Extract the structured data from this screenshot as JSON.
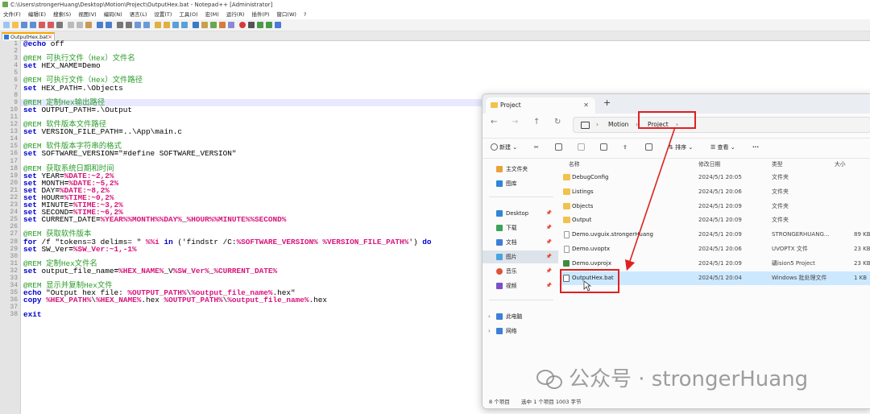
{
  "npp": {
    "title": "C:\\Users\\strongerHuang\\Desktop\\Motion\\Project\\OutputHex.bat - Notepad++ [Administrator]",
    "menu": [
      "文件(F)",
      "编辑(E)",
      "搜索(S)",
      "视图(V)",
      "编码(N)",
      "语言(L)",
      "设置(T)",
      "工具(O)",
      "宏(M)",
      "运行(R)",
      "插件(P)",
      "窗口(W)",
      "?"
    ],
    "tab_label": "OutputHex.bat",
    "lines": [
      {
        "n": "1",
        "t": [
          {
            "c": "kw",
            "s": "@echo"
          },
          {
            "c": "",
            "s": " off"
          }
        ]
      },
      {
        "n": "2",
        "t": []
      },
      {
        "n": "3",
        "t": [
          {
            "c": "cm",
            "s": "@REM 可执行文件（Hex）文件名"
          }
        ]
      },
      {
        "n": "4",
        "t": [
          {
            "c": "kw",
            "s": "set"
          },
          {
            "c": "",
            "s": " HEX_NAME"
          },
          {
            "c": "op",
            "s": "="
          },
          {
            "c": "",
            "s": "Demo"
          }
        ]
      },
      {
        "n": "5",
        "t": []
      },
      {
        "n": "6",
        "t": [
          {
            "c": "cm",
            "s": "@REM 可执行文件（Hex）文件路径"
          }
        ]
      },
      {
        "n": "7",
        "t": [
          {
            "c": "kw",
            "s": "set"
          },
          {
            "c": "",
            "s": " HEX_PATH"
          },
          {
            "c": "op",
            "s": "="
          },
          {
            "c": "",
            "s": ".\\Objects"
          }
        ]
      },
      {
        "n": "8",
        "t": []
      },
      {
        "n": "9",
        "t": [
          {
            "c": "cm",
            "s": "@REM 定制Hex输出路径"
          }
        ],
        "cur": true
      },
      {
        "n": "10",
        "t": [
          {
            "c": "kw",
            "s": "set"
          },
          {
            "c": "",
            "s": " OUTPUT_PATH"
          },
          {
            "c": "op",
            "s": "="
          },
          {
            "c": "",
            "s": ".\\Output"
          }
        ]
      },
      {
        "n": "11",
        "t": []
      },
      {
        "n": "12",
        "t": [
          {
            "c": "cm",
            "s": "@REM 软件版本文件路径"
          }
        ]
      },
      {
        "n": "13",
        "t": [
          {
            "c": "kw",
            "s": "set"
          },
          {
            "c": "",
            "s": " VERSION_FILE_PATH"
          },
          {
            "c": "op",
            "s": "="
          },
          {
            "c": "",
            "s": "..\\App\\main.c"
          }
        ]
      },
      {
        "n": "14",
        "t": []
      },
      {
        "n": "15",
        "t": [
          {
            "c": "cm",
            "s": "@REM 软件版本字符串的格式"
          }
        ]
      },
      {
        "n": "16",
        "t": [
          {
            "c": "kw",
            "s": "set"
          },
          {
            "c": "",
            "s": " SOFTWARE_VERSION"
          },
          {
            "c": "op",
            "s": "="
          },
          {
            "c": "",
            "s": "\"#define SOFTWARE_VERSION\""
          }
        ]
      },
      {
        "n": "17",
        "t": []
      },
      {
        "n": "18",
        "t": [
          {
            "c": "cm",
            "s": "@REM 获取系统日期和时间"
          }
        ]
      },
      {
        "n": "19",
        "t": [
          {
            "c": "kw",
            "s": "set"
          },
          {
            "c": "",
            "s": " YEAR"
          },
          {
            "c": "op",
            "s": "="
          },
          {
            "c": "var",
            "s": "%DATE:~2,2%"
          }
        ]
      },
      {
        "n": "20",
        "t": [
          {
            "c": "kw",
            "s": "set"
          },
          {
            "c": "",
            "s": " MONTH"
          },
          {
            "c": "op",
            "s": "="
          },
          {
            "c": "var",
            "s": "%DATE:~5,2%"
          }
        ]
      },
      {
        "n": "21",
        "t": [
          {
            "c": "kw",
            "s": "set"
          },
          {
            "c": "",
            "s": " DAY"
          },
          {
            "c": "op",
            "s": "="
          },
          {
            "c": "var",
            "s": "%DATE:~8,2%"
          }
        ]
      },
      {
        "n": "22",
        "t": [
          {
            "c": "kw",
            "s": "set"
          },
          {
            "c": "",
            "s": " HOUR"
          },
          {
            "c": "op",
            "s": "="
          },
          {
            "c": "var",
            "s": "%TIME:~0,2%"
          }
        ]
      },
      {
        "n": "23",
        "t": [
          {
            "c": "kw",
            "s": "set"
          },
          {
            "c": "",
            "s": " MINUTE"
          },
          {
            "c": "op",
            "s": "="
          },
          {
            "c": "var",
            "s": "%TIME:~3,2%"
          }
        ]
      },
      {
        "n": "24",
        "t": [
          {
            "c": "kw",
            "s": "set"
          },
          {
            "c": "",
            "s": " SECOND"
          },
          {
            "c": "op",
            "s": "="
          },
          {
            "c": "var",
            "s": "%TIME:~6,2%"
          }
        ]
      },
      {
        "n": "25",
        "t": [
          {
            "c": "kw",
            "s": "set"
          },
          {
            "c": "",
            "s": " CURRENT_DATE"
          },
          {
            "c": "op",
            "s": "="
          },
          {
            "c": "var",
            "s": "%YEAR%%MONTH%%DAY%"
          },
          {
            "c": "",
            "s": "_"
          },
          {
            "c": "var",
            "s": "%HOUR%%MINUTE%%SECOND%"
          }
        ]
      },
      {
        "n": "26",
        "t": []
      },
      {
        "n": "27",
        "t": [
          {
            "c": "cm",
            "s": "@REM 获取软件版本"
          }
        ]
      },
      {
        "n": "28",
        "t": [
          {
            "c": "kw",
            "s": "for"
          },
          {
            "c": "",
            "s": " /f \"tokens=3 delims= \" "
          },
          {
            "c": "var",
            "s": "%%i"
          },
          {
            "c": "",
            "s": " "
          },
          {
            "c": "kw",
            "s": "in"
          },
          {
            "c": "",
            "s": " ('findstr /C:"
          },
          {
            "c": "var",
            "s": "%SOFTWARE_VERSION%"
          },
          {
            "c": "",
            "s": " "
          },
          {
            "c": "var",
            "s": "%VERSION_FILE_PATH%"
          },
          {
            "c": "",
            "s": "') "
          },
          {
            "c": "kw",
            "s": "do"
          }
        ]
      },
      {
        "n": "29",
        "t": [
          {
            "c": "kw",
            "s": "set"
          },
          {
            "c": "",
            "s": " SW_Ver"
          },
          {
            "c": "op",
            "s": "="
          },
          {
            "c": "var",
            "s": "%SW_Ver:~1,-1%"
          }
        ]
      },
      {
        "n": "30",
        "t": []
      },
      {
        "n": "31",
        "t": [
          {
            "c": "cm",
            "s": "@REM 定制Hex文件名"
          }
        ]
      },
      {
        "n": "32",
        "t": [
          {
            "c": "kw",
            "s": "set"
          },
          {
            "c": "",
            "s": " output_file_name"
          },
          {
            "c": "op",
            "s": "="
          },
          {
            "c": "var",
            "s": "%HEX_NAME%"
          },
          {
            "c": "",
            "s": "_V"
          },
          {
            "c": "var",
            "s": "%SW_Ver%"
          },
          {
            "c": "",
            "s": "_"
          },
          {
            "c": "var",
            "s": "%CURRENT_DATE%"
          }
        ]
      },
      {
        "n": "33",
        "t": []
      },
      {
        "n": "34",
        "t": [
          {
            "c": "cm",
            "s": "@REM 显示并复制Hex文件"
          }
        ]
      },
      {
        "n": "35",
        "t": [
          {
            "c": "kw",
            "s": "echo"
          },
          {
            "c": "",
            "s": " \"Output hex file: "
          },
          {
            "c": "var",
            "s": "%OUTPUT_PATH%"
          },
          {
            "c": "",
            "s": "\\"
          },
          {
            "c": "var",
            "s": "%output_file_name%"
          },
          {
            "c": "",
            "s": ".hex\""
          }
        ]
      },
      {
        "n": "36",
        "t": [
          {
            "c": "kw",
            "s": "copy"
          },
          {
            "c": "",
            "s": " "
          },
          {
            "c": "var",
            "s": "%HEX_PATH%"
          },
          {
            "c": "",
            "s": "\\"
          },
          {
            "c": "var",
            "s": "%HEX_NAME%"
          },
          {
            "c": "",
            "s": ".hex "
          },
          {
            "c": "var",
            "s": "%OUTPUT_PATH%"
          },
          {
            "c": "",
            "s": "\\"
          },
          {
            "c": "var",
            "s": "%output_file_name%"
          },
          {
            "c": "",
            "s": ".hex"
          }
        ]
      },
      {
        "n": "37",
        "t": []
      },
      {
        "n": "38",
        "t": [
          {
            "c": "kw",
            "s": "exit"
          }
        ]
      }
    ]
  },
  "explorer": {
    "tab_title": "Project",
    "tab_close": "✕",
    "new_tab": "+",
    "breadcrumb": [
      "Motion",
      "Project"
    ],
    "commands": {
      "new": "新建",
      "sort": "排序",
      "view": "查看",
      "more": "···"
    },
    "nav": {
      "home": "主文件夹",
      "gallery": "图库",
      "desktop": "Desktop",
      "downloads": "下载",
      "documents": "文档",
      "pictures": "图片",
      "music": "音乐",
      "videos": "视频",
      "this_pc": "此电脑",
      "network": "网络"
    },
    "columns": [
      "名称",
      "修改日期",
      "类型",
      "大小"
    ],
    "files": [
      {
        "name": "DebugConfig",
        "date": "2024/5/1 20:05",
        "type": "文件夹",
        "size": "",
        "icon": "folder"
      },
      {
        "name": "Listings",
        "date": "2024/5/1 20:06",
        "type": "文件夹",
        "size": "",
        "icon": "folder"
      },
      {
        "name": "Objects",
        "date": "2024/5/1 20:09",
        "type": "文件夹",
        "size": "",
        "icon": "folder"
      },
      {
        "name": "Output",
        "date": "2024/5/1 20:09",
        "type": "文件夹",
        "size": "",
        "icon": "folder"
      },
      {
        "name": "Demo.uvguix.strongerHuang",
        "date": "2024/5/1 20:09",
        "type": "STRONGERHUANG...",
        "size": "89 KB",
        "icon": "file"
      },
      {
        "name": "Demo.uvoptx",
        "date": "2024/5/1 20:06",
        "type": "UVOPTX 文件",
        "size": "23 KB",
        "icon": "file"
      },
      {
        "name": "Demo.uvprojx",
        "date": "2024/5/1 20:09",
        "type": "礦ision5 Project",
        "size": "23 KB",
        "icon": "proj"
      },
      {
        "name": "OutputHex.bat",
        "date": "2024/5/1 20:04",
        "type": "Windows 批处理文件",
        "size": "1 KB",
        "icon": "bat",
        "selected": true
      }
    ],
    "status_count": "8 个项目",
    "status_selected": "选中 1 个项目  1003 字节"
  },
  "watermark": {
    "text": "公众号 · strongerHuang"
  },
  "colors": {
    "highlight": "#e02020",
    "keyword": "#0000cc",
    "comment": "#2a9d2a",
    "variable": "#d7137a"
  }
}
